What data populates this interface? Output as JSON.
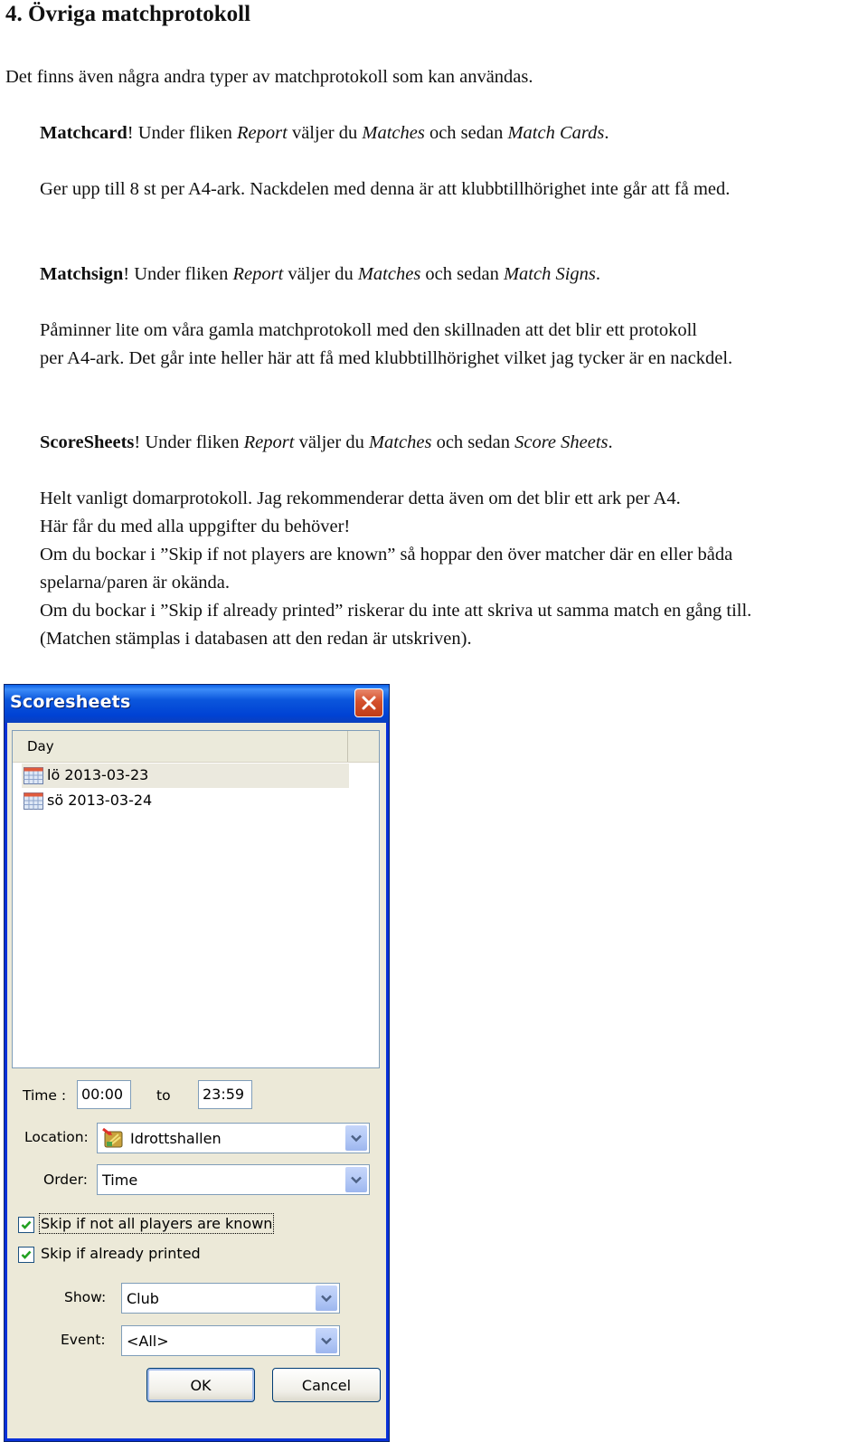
{
  "heading": "4. Övriga matchprotokoll",
  "intro": "Det finns även några andra typer av matchprotokoll som kan användas.",
  "sections": [
    {
      "name": "Matchcard",
      "exclaim": "!",
      "under": " Under fliken ",
      "tab": "Report",
      "choose": " väljer du ",
      "menu": "Matches",
      "then": " och sedan ",
      "item": "Match Cards",
      "end": ".",
      "lines": [
        "Ger upp till 8 st per A4-ark. Nackdelen med denna är att klubbtillhörighet inte går att få med."
      ]
    },
    {
      "name": "Matchsign",
      "exclaim": "!",
      "under": " Under fliken ",
      "tab": "Report",
      "choose": " väljer du ",
      "menu": "Matches",
      "then": " och sedan ",
      "item": "Match Signs",
      "end": ".",
      "lines": [
        "Påminner lite om våra gamla matchprotokoll med den skillnaden att det blir ett protokoll",
        "per A4-ark. Det går inte heller här att få med klubbtillhörighet vilket jag tycker är en nackdel."
      ]
    },
    {
      "name": "ScoreSheets",
      "exclaim": "!",
      "under": " Under fliken ",
      "tab": "Report",
      "choose": " väljer du ",
      "menu": "Matches",
      "then": " och sedan ",
      "item": "Score Sheets",
      "end": ".",
      "lines": [
        "Helt vanligt domarprotokoll. Jag rekommenderar detta även om det blir ett ark per A4.",
        "Här får du med alla uppgifter du behöver!",
        "Om du bockar i ”Skip if not players are known” så hoppar den över matcher där en eller båda",
        "spelarna/paren är okända.",
        "Om du bockar i ”Skip if already printed” riskerar du inte att skriva ut samma match en gång till.",
        "(Matchen stämplas i databasen att den redan är utskriven)."
      ]
    }
  ],
  "dialog": {
    "title": "Scoresheets",
    "close_icon": "close-icon",
    "list": {
      "column_header": "Day",
      "items": [
        {
          "label": "lö 2013-03-23",
          "icon": "calendar-icon",
          "selected": true
        },
        {
          "label": "sö 2013-03-24",
          "icon": "calendar-icon",
          "selected": false
        }
      ]
    },
    "time_label": "Time :",
    "time_from": "00:00",
    "time_to_label": "to",
    "time_to": "23:59",
    "location_label": "Location:",
    "location_value": "Idrottshallen",
    "location_icon": "venue-icon",
    "order_label": "Order:",
    "order_value": "Time",
    "checkboxes": [
      {
        "label": "Skip if not all players are known",
        "checked": true
      },
      {
        "label": "Skip if already printed",
        "checked": true
      }
    ],
    "show_label": "Show:",
    "show_value": "Club",
    "event_label": "Event:",
    "event_value": "<All>",
    "ok_label": "OK",
    "cancel_label": "Cancel"
  }
}
